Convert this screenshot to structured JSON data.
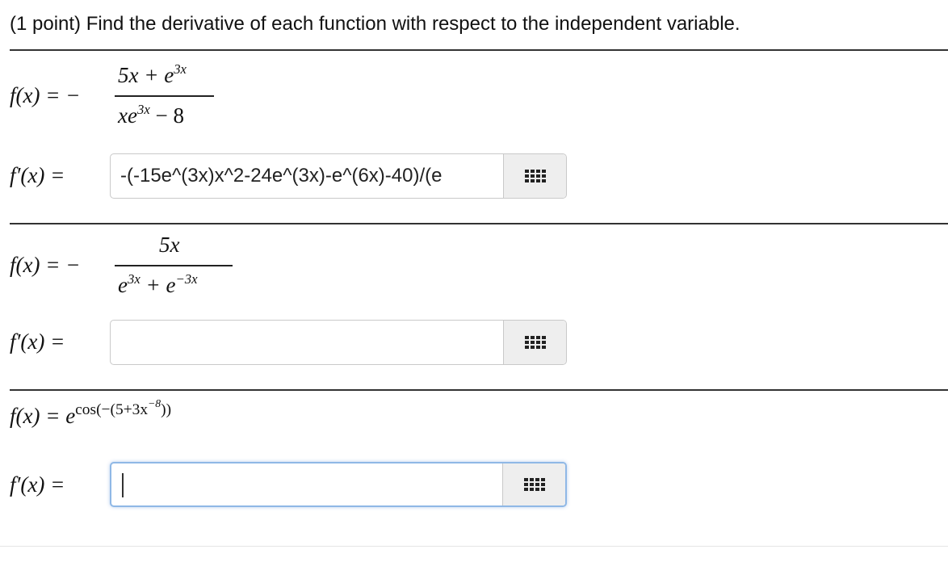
{
  "problem": {
    "header": "(1 point) Find the derivative of each function with respect to the independent variable."
  },
  "parts": [
    {
      "fx_label": "f(x) = −",
      "numerator": "5x + e",
      "numerator_sup": "3x",
      "denominator_a": "xe",
      "denominator_sup": "3x",
      "denominator_b": " − 8",
      "dfx_label": "f′(x) =",
      "answer_value": "-(-15e^(3x)x^2-24e^(3x)-e^(6x)-40)/(e",
      "answer_icon": "grid-icon"
    },
    {
      "fx_label": "f(x) = −",
      "numerator": "5x",
      "denominator_a": "e",
      "denominator_sup": "3x",
      "denominator_mid": " + e",
      "denominator_sup2": "−3x",
      "dfx_label": "f′(x) =",
      "answer_value": "",
      "answer_icon": "grid-icon"
    },
    {
      "fx_label": "f(x) = e",
      "exp": "cos(−(5+3x",
      "exp_sup": "−8",
      "exp_tail": "))",
      "dfx_label": "f′(x) =",
      "answer_value": "",
      "answer_icon": "grid-icon",
      "focused": true
    }
  ]
}
